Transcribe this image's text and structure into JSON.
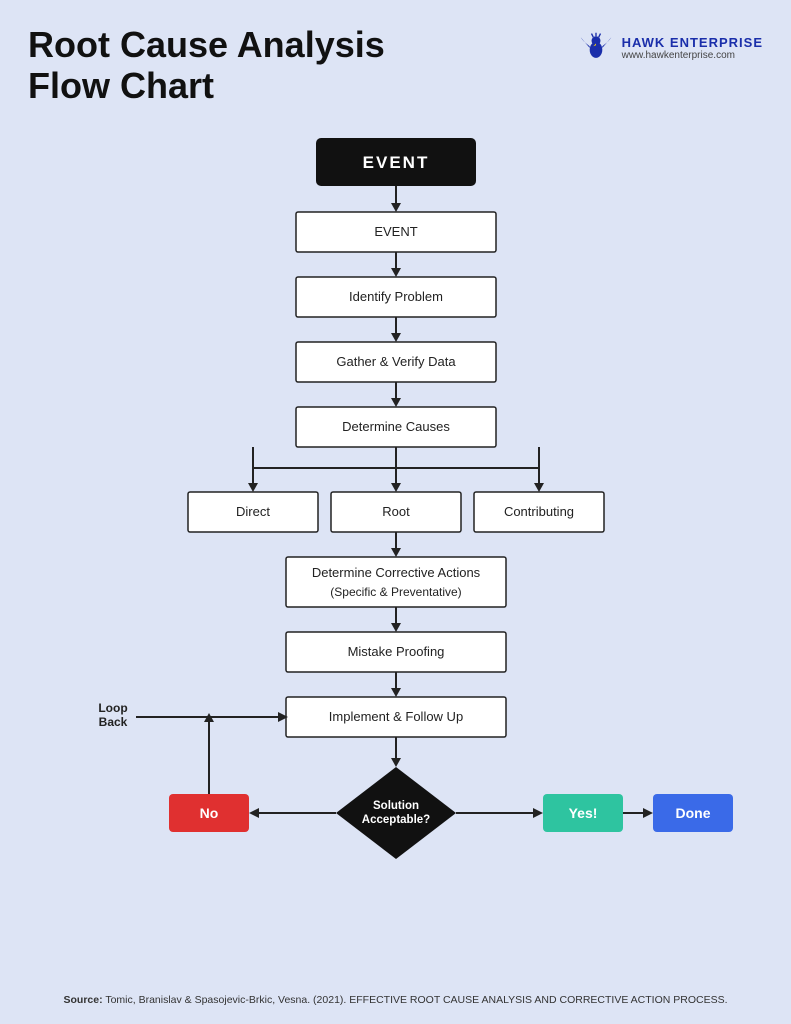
{
  "header": {
    "title_line1": "Root Cause Analysis",
    "title_line2": "Flow Chart",
    "logo_name": "HAWK ENTERPRISE",
    "logo_url": "www.hawkenterprise.com"
  },
  "flowchart": {
    "nodes": {
      "event_main": "EVENT",
      "event": "EVENT",
      "identify_problem": "Identify Problem",
      "gather_verify": "Gather & Verify Data",
      "determine_causes": "Determine Causes",
      "direct": "Direct",
      "root": "Root",
      "contributing": "Contributing",
      "determine_corrective": "Determine Corrective Actions",
      "specific_preventative": "(Specific & Preventative)",
      "mistake_proofing": "Mistake Proofing",
      "implement_follow": "Implement & Follow Up",
      "solution_acceptable": "Solution Acceptable?",
      "loop_back": "Loop Back",
      "no": "No",
      "yes": "Yes!",
      "done": "Done"
    }
  },
  "source": {
    "label": "Source:",
    "text": "Tomic, Branislav & Spasojevic-Brkic, Vesna. (2021). EFFECTIVE ROOT CAUSE ANALYSIS AND CORRECTIVE ACTION PROCESS."
  }
}
